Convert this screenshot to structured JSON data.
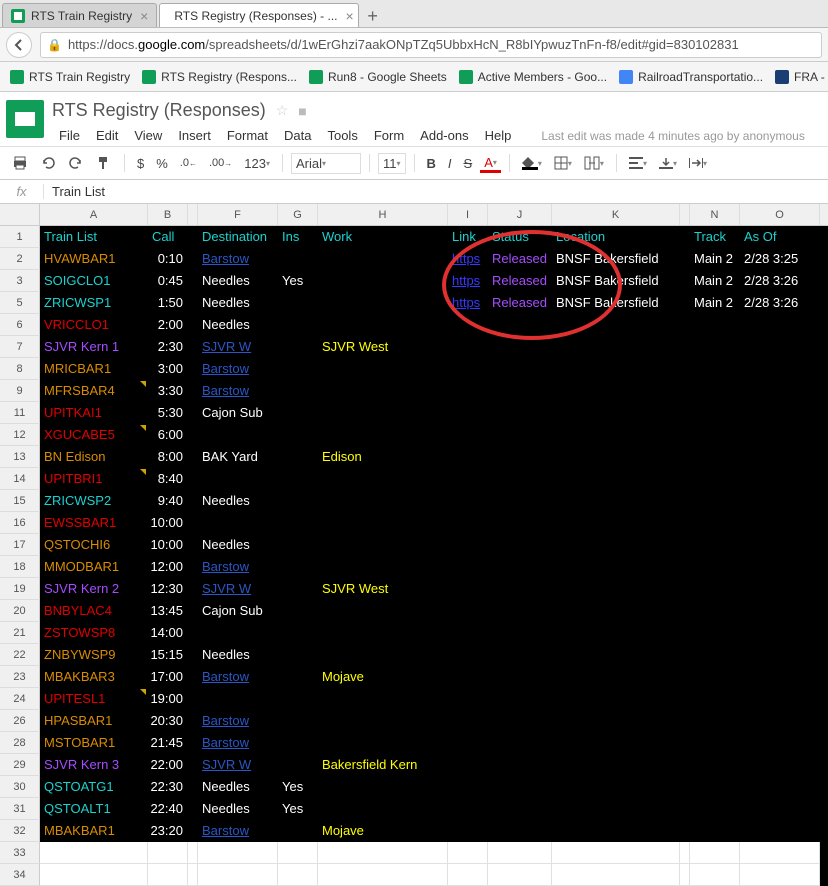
{
  "tabs": {
    "t1": "RTS Train Registry",
    "t2": "RTS Registry (Responses) - ...",
    "close": "×",
    "new": "+"
  },
  "url": {
    "lock": "🔒",
    "pre": "https://docs.",
    "dom": "google.com",
    "post": "/spreadsheets/d/1wErGhzi7aakONpTZq5UbbxHcN_R8bIYpwuzTnFn-f8/edit#gid=830102831"
  },
  "bookmarks": {
    "b1": "RTS Train Registry",
    "b2": "RTS Registry (Respons...",
    "b3": "Run8 - Google Sheets",
    "b4": "Active Members - Goo...",
    "b5": "RailroadTransportatio...",
    "b6": "FRA - Safety M"
  },
  "doc": {
    "title": "RTS Registry (Responses)",
    "star": "☆",
    "folder": "■"
  },
  "menu": {
    "file": "File",
    "edit": "Edit",
    "view": "View",
    "insert": "Insert",
    "format": "Format",
    "data": "Data",
    "tools": "Tools",
    "form": "Form",
    "addons": "Add-ons",
    "help": "Help",
    "last": "Last edit was made 4 minutes ago by anonymous"
  },
  "toolbar": {
    "dollar": "$",
    "pct": "%",
    "dec0": ".0",
    "dec00": ".00",
    "n123": "123",
    "font": "Arial",
    "size": "11",
    "bold": "B",
    "italic": "I",
    "strike": "S",
    "A": "A"
  },
  "fx": {
    "label": "fx",
    "value": "Train List"
  },
  "cols": {
    "A": "A",
    "B": "B",
    "G": "",
    "F": "F",
    "Gc": "G",
    "H": "H",
    "I": "I",
    "J": "J",
    "K": "K",
    "L": "",
    "N": "N",
    "O": "O",
    "arrows": "◂ ▸"
  },
  "headers": {
    "train": "Train List",
    "call": "Call",
    "dest": "Destination",
    "ins": "Ins",
    "work": "Work",
    "link": "Link",
    "status": "Status",
    "loc": "Location",
    "track": "Track",
    "asof": "As Of"
  },
  "dest": {
    "barstow": "Barstow",
    "needles": "Needles",
    "cajon": "Cajon Sub",
    "sjvrw": "SJVR W",
    "bakyard": "BAK Yard"
  },
  "work": {
    "sjvrwest": "SJVR West",
    "edison": "Edison",
    "mojave": "Mojave",
    "bkern": "Bakersfield Kern",
    "yes": "Yes"
  },
  "https": "https",
  "released": "Released",
  "bnsfbak": "BNSF Bakersfield",
  "main2": "Main 2",
  "t325": "2/28 3:25",
  "t326": "2/28 3:26",
  "rows": [
    {
      "n": "1"
    },
    {
      "n": "2",
      "tr": "HVAWBAR1",
      "c": "#d98c00",
      "call": "0:10",
      "dest": "barstow",
      "dl": true,
      "https": true,
      "rel": true,
      "loc": true,
      "track": true,
      "asof": "t325"
    },
    {
      "n": "3",
      "tr": "SOIGCLO1",
      "c": "#1cd2cf",
      "call": "0:45",
      "dest": "needles",
      "ins": "yes",
      "https": true,
      "rel": true,
      "loc": true,
      "track": true,
      "asof": "t326"
    },
    {
      "n": "5",
      "tr": "ZRICWSP1",
      "c": "#1cd2cf",
      "call": "1:50",
      "dest": "needles",
      "https": true,
      "rel": true,
      "loc": true,
      "track": true,
      "asof": "t326",
      "ra": true
    },
    {
      "n": "6",
      "tr": "VRICCLO1",
      "c": "#e00000",
      "call": "2:00",
      "dest": "needles"
    },
    {
      "n": "7",
      "tr": "SJVR Kern 1",
      "c": "#a64dff",
      "call": "2:30",
      "dest": "sjvrw",
      "dl": true,
      "work": "sjvrwest"
    },
    {
      "n": "8",
      "tr": "MRICBAR1",
      "c": "#d98c00",
      "call": "3:00",
      "dest": "barstow",
      "dl": true
    },
    {
      "n": "9",
      "tr": "MFRSBAR4",
      "c": "#d98c00",
      "call": "3:30",
      "dest": "barstow",
      "dl": true,
      "tri": true
    },
    {
      "n": "11",
      "tr": "UPITKAI1",
      "c": "#e00000",
      "call": "5:30",
      "dest": "cajon",
      "ra": true
    },
    {
      "n": "12",
      "tr": "XGUCABE5",
      "c": "#e00000",
      "call": "6:00",
      "tri": true
    },
    {
      "n": "13",
      "tr": "BN Edison",
      "c": "#d98c00",
      "call": "8:00",
      "dest": "bakyard",
      "work": "edison"
    },
    {
      "n": "14",
      "tr": "UPITBRI1",
      "c": "#e00000",
      "call": "8:40",
      "tri": true
    },
    {
      "n": "15",
      "tr": "ZRICWSP2",
      "c": "#1cd2cf",
      "call": "9:40",
      "dest": "needles"
    },
    {
      "n": "16",
      "tr": "EWSSBAR1",
      "c": "#e00000",
      "call": "10:00"
    },
    {
      "n": "17",
      "tr": "QSTOCHI6",
      "c": "#d98c00",
      "call": "10:00",
      "dest": "needles"
    },
    {
      "n": "18",
      "tr": "MMODBAR1",
      "c": "#d98c00",
      "call": "12:00",
      "dest": "barstow",
      "dl": true
    },
    {
      "n": "19",
      "tr": "SJVR Kern 2",
      "c": "#a64dff",
      "call": "12:30",
      "dest": "sjvrw",
      "dl": true,
      "work": "sjvrwest"
    },
    {
      "n": "20",
      "tr": "BNBYLAC4",
      "c": "#e00000",
      "call": "13:45",
      "dest": "cajon"
    },
    {
      "n": "21",
      "tr": "ZSTOWSP8",
      "c": "#e00000",
      "call": "14:00"
    },
    {
      "n": "22",
      "tr": "ZNBYWSP9",
      "c": "#d98c00",
      "call": "15:15",
      "dest": "needles"
    },
    {
      "n": "23",
      "tr": "MBAKBAR3",
      "c": "#d98c00",
      "call": "17:00",
      "dest": "barstow",
      "dl": true,
      "work": "mojave"
    },
    {
      "n": "24",
      "tr": "UPITESL1",
      "c": "#e00000",
      "call": "19:00",
      "tri": true,
      "ra": true
    },
    {
      "n": "26",
      "tr": "HPASBAR1",
      "c": "#d98c00",
      "call": "20:30",
      "dest": "barstow",
      "dl": true,
      "ra": true
    },
    {
      "n": "28",
      "tr": "MSTOBAR1",
      "c": "#d98c00",
      "call": "21:45",
      "dest": "barstow",
      "dl": true,
      "ra": true
    },
    {
      "n": "29",
      "tr": "SJVR Kern 3",
      "c": "#a64dff",
      "call": "22:00",
      "dest": "sjvrw",
      "dl": true,
      "work": "bkern"
    },
    {
      "n": "30",
      "tr": "QSTOATG1",
      "c": "#1cd2cf",
      "call": "22:30",
      "dest": "needles",
      "ins": "yes"
    },
    {
      "n": "31",
      "tr": "QSTOALT1",
      "c": "#1cd2cf",
      "call": "22:40",
      "dest": "needles",
      "ins": "yes"
    },
    {
      "n": "32",
      "tr": "MBAKBAR1",
      "c": "#d98c00",
      "call": "23:20",
      "dest": "barstow",
      "dl": true,
      "work": "mojave"
    },
    {
      "n": "33",
      "empty": true
    },
    {
      "n": "34",
      "empty": true
    }
  ]
}
